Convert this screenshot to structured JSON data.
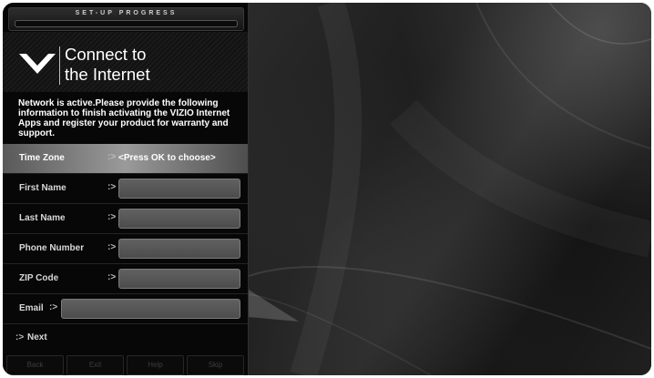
{
  "progress": {
    "label": "SET-UP PROGRESS"
  },
  "header": {
    "logo_icon": "vizio-v-logo-icon",
    "title_line1": "Connect to",
    "title_line2": "the Internet"
  },
  "description": "Network is active.Please provide the following information to finish activating the VIZIO Internet Apps and register your product for warranty and support.",
  "form": {
    "time_zone": {
      "label": "Time Zone",
      "value": "<Press OK to choose>"
    },
    "first_name": {
      "label": "First Name",
      "value": ""
    },
    "last_name": {
      "label": "Last Name",
      "value": ""
    },
    "phone_number": {
      "label": "Phone Number",
      "value": ""
    },
    "zip_code": {
      "label": "ZIP Code",
      "value": ""
    },
    "email": {
      "label": "Email",
      "value": ""
    }
  },
  "next_label": "Next",
  "arrow_glyph": ":>",
  "softkeys": {
    "back": "Back",
    "exit": "Exit",
    "help": "Help",
    "skip": "Skip"
  },
  "colors": {
    "panel": "#070707",
    "selected_row": "#9a9a9a",
    "field": "#5a5a5a",
    "text": "#ffffff"
  }
}
